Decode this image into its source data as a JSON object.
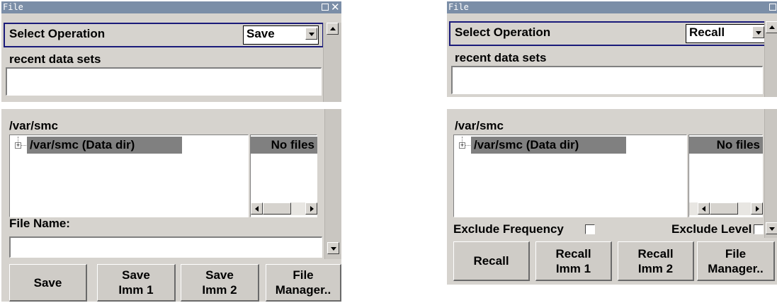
{
  "left_dialog": {
    "title": "File",
    "select_operation_label": "Select Operation",
    "operation_value": "Save",
    "recent_label": "recent data sets",
    "path": "/var/smc",
    "tree_item": "/var/smc (Data dir)",
    "files_status": "No files",
    "file_name_label": "File Name:",
    "file_name_value": "",
    "buttons": [
      "Save",
      "Save\nImm 1",
      "Save\nImm 2",
      "File\nManager.."
    ]
  },
  "right_dialog": {
    "title": "File",
    "select_operation_label": "Select Operation",
    "operation_value": "Recall",
    "recent_label": "recent data sets",
    "path": "/var/smc",
    "tree_item": "/var/smc (Data dir)",
    "files_status": "No files",
    "exclude_frequency_label": "Exclude Frequency",
    "exclude_frequency_checked": false,
    "exclude_level_label": "Exclude Level",
    "exclude_level_checked": false,
    "buttons": [
      "Recall",
      "Recall\nImm 1",
      "Recall\nImm 2",
      "File\nManager.."
    ]
  },
  "colors": {
    "titlebar": "#7b8ea7",
    "panel": "#d6d3ce",
    "selection": "#808080",
    "focus_frame": "#1a1a7a"
  }
}
